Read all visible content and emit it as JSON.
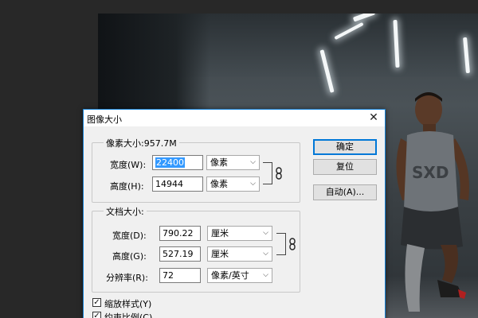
{
  "dialog": {
    "title": "图像大小",
    "close_glyph": "✕",
    "pixel_group": {
      "title": "像素大小:957.7M",
      "width_label": "宽度(W):",
      "width_value": "22400",
      "width_unit": "像素",
      "height_label": "高度(H):",
      "height_value": "14944",
      "height_unit": "像素"
    },
    "doc_group": {
      "title": "文档大小:",
      "width_label": "宽度(D):",
      "width_value": "790.22",
      "width_unit": "厘米",
      "height_label": "高度(G):",
      "height_value": "527.19",
      "height_unit": "厘米",
      "res_label": "分辨率(R):",
      "res_value": "72",
      "res_unit": "像素/英寸"
    },
    "buttons": {
      "ok": "确定",
      "reset": "复位",
      "auto": "自动(A)..."
    },
    "checkboxes": {
      "scale_styles": "缩放样式(Y)",
      "constrain": "约束比例(C)"
    }
  },
  "icons": {
    "link": "chain-link-icon",
    "chevron": "chevron-down-icon",
    "check": "checkmark-icon"
  },
  "colors": {
    "dialog_border": "#1883d7",
    "selection": "#3399ff",
    "default_button_border": "#0078d7"
  }
}
